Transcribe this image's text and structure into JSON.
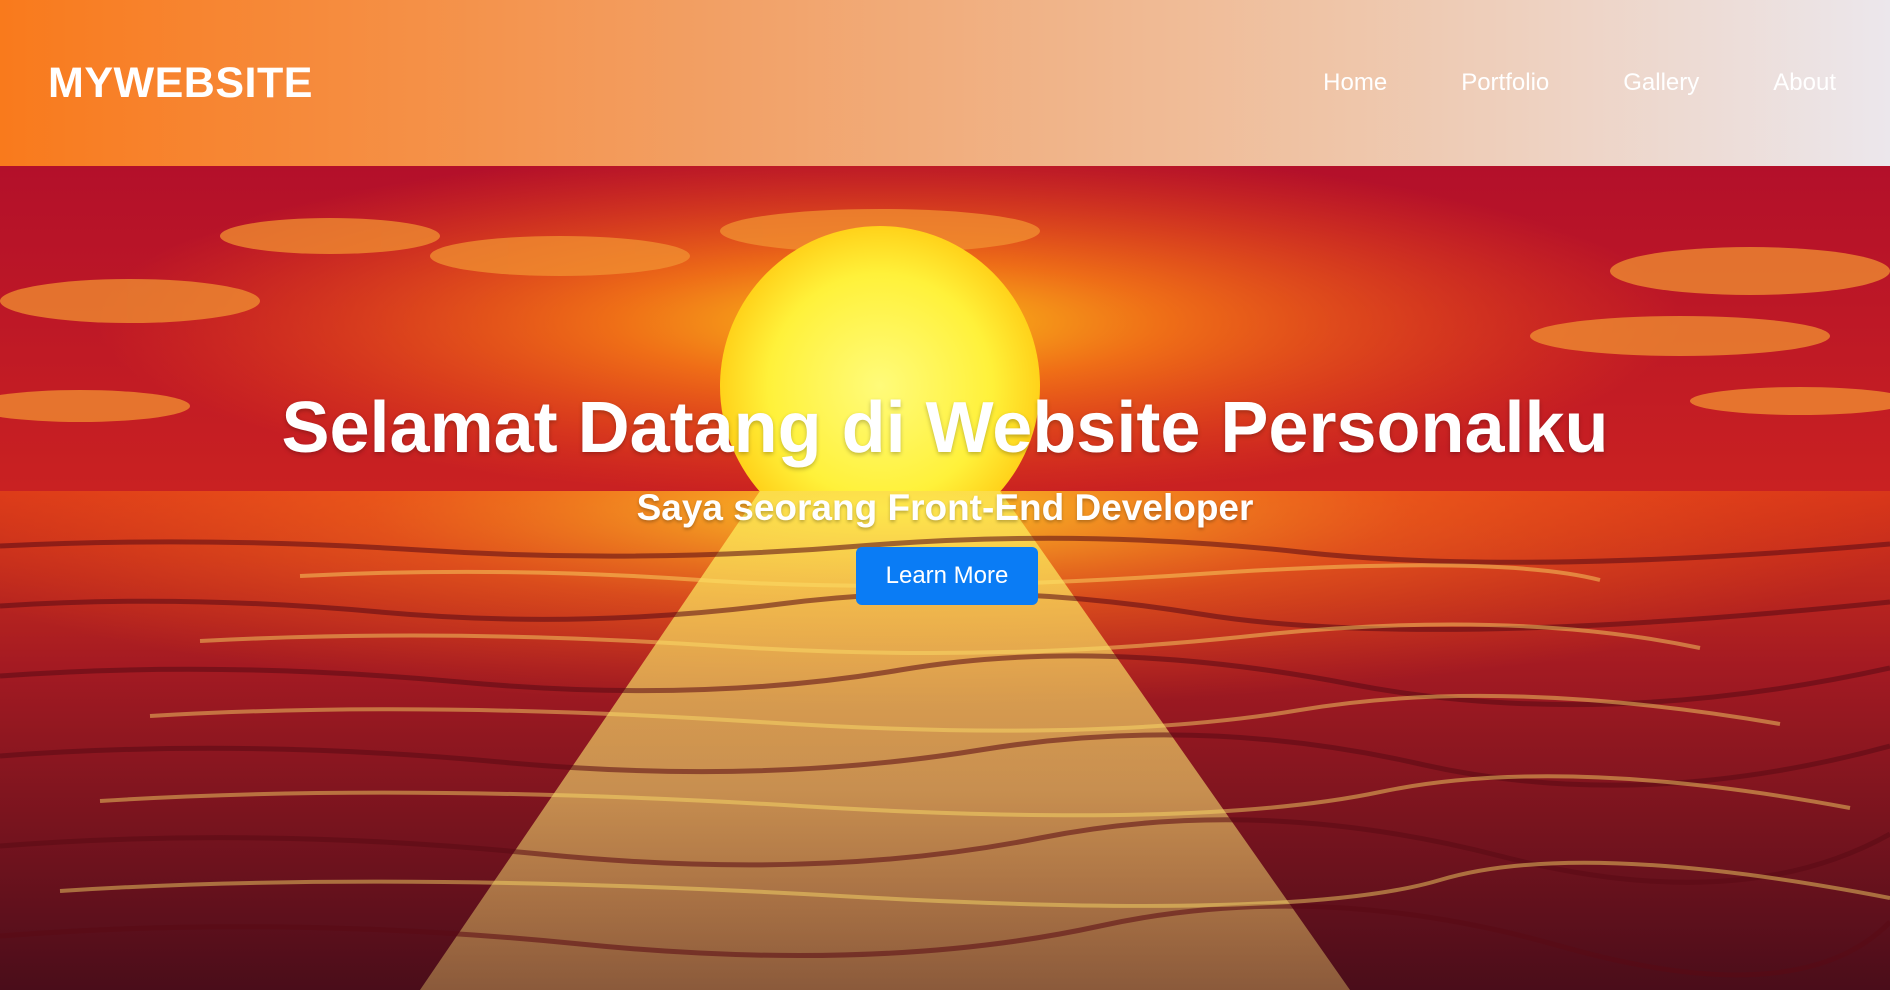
{
  "header": {
    "brand": "MYWEBSITE",
    "nav": [
      {
        "label": "Home"
      },
      {
        "label": "Portfolio"
      },
      {
        "label": "Gallery"
      },
      {
        "label": "About"
      }
    ]
  },
  "hero": {
    "title": "Selamat Datang di Website Personalku",
    "subtitle": "Saya seorang Front-End Developer",
    "button_label": "Learn More",
    "background_image": "sunset-over-ocean"
  },
  "colors": {
    "header_gradient_start": "#f97a1c",
    "header_gradient_end": "#ece7ec",
    "button": "#0a7cf5",
    "text": "#ffffff"
  }
}
